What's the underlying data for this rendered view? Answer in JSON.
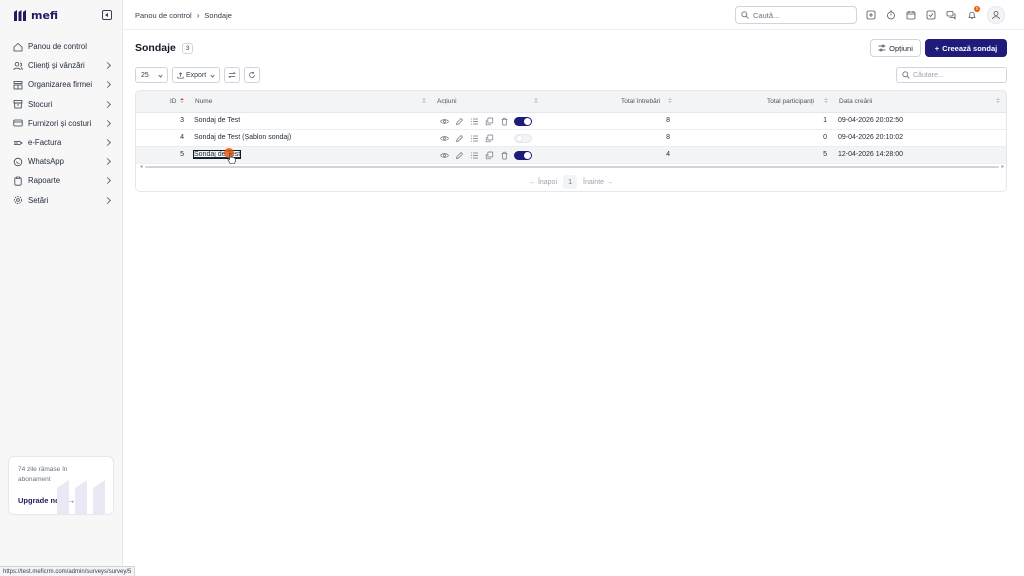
{
  "app": {
    "logo_text": "mefi"
  },
  "sidebar": {
    "items": [
      {
        "label": "Panou de control",
        "icon": "home-icon",
        "has_chevron": false
      },
      {
        "label": "Clienți și vânzări",
        "icon": "users-icon",
        "has_chevron": true
      },
      {
        "label": "Organizarea firmei",
        "icon": "building-icon",
        "has_chevron": true
      },
      {
        "label": "Stocuri",
        "icon": "box-icon",
        "has_chevron": true
      },
      {
        "label": "Furnizori și costuri",
        "icon": "card-icon",
        "has_chevron": true
      },
      {
        "label": "e-Factura",
        "icon": "efactura-icon",
        "has_chevron": true
      },
      {
        "label": "WhatsApp",
        "icon": "chat-icon",
        "has_chevron": true
      },
      {
        "label": "Rapoarte",
        "icon": "clipboard-icon",
        "has_chevron": true
      },
      {
        "label": "Setări",
        "icon": "gear-icon",
        "has_chevron": true
      }
    ],
    "upgrade": {
      "days_text": "74 zile rămase în abonament",
      "link": "Upgrade now"
    }
  },
  "header": {
    "breadcrumb": [
      "Panou de control",
      "Sondaje"
    ],
    "search_placeholder": "Caută...",
    "notification_count": "0"
  },
  "page": {
    "title": "Sondaje",
    "count": "3",
    "options_label": "Opțiuni",
    "create_label": "Creează sondaj"
  },
  "toolbar": {
    "page_size": "25",
    "export_label": "Export",
    "search_placeholder": "Căutare..."
  },
  "table": {
    "columns": [
      "ID",
      "Nume",
      "Acțiuni",
      "Total întrebări",
      "Total participanți",
      "Data creării"
    ],
    "rows": [
      {
        "id": "3",
        "name": "Sondaj de Test",
        "active": true,
        "questions": "8",
        "participants": "1",
        "created": "09-04-2026 20:02:50"
      },
      {
        "id": "4",
        "name": "Sondaj de Test (Șablon sondaj)",
        "active": false,
        "questions": "8",
        "participants": "0",
        "created": "09-04-2026 20:10:02"
      },
      {
        "id": "5",
        "name": "Sondaj de Test",
        "active": true,
        "questions": "4",
        "participants": "5",
        "created": "12-04-2026 14:28:00"
      }
    ],
    "pager": {
      "prev": "Înapoi",
      "page": "1",
      "next": "Înainte"
    }
  },
  "status_bar_url": "https://test.meficrm.com/admin/surveys/survey/5",
  "colors": {
    "primary": "#1e1b7b",
    "accent": "#ea580c"
  }
}
